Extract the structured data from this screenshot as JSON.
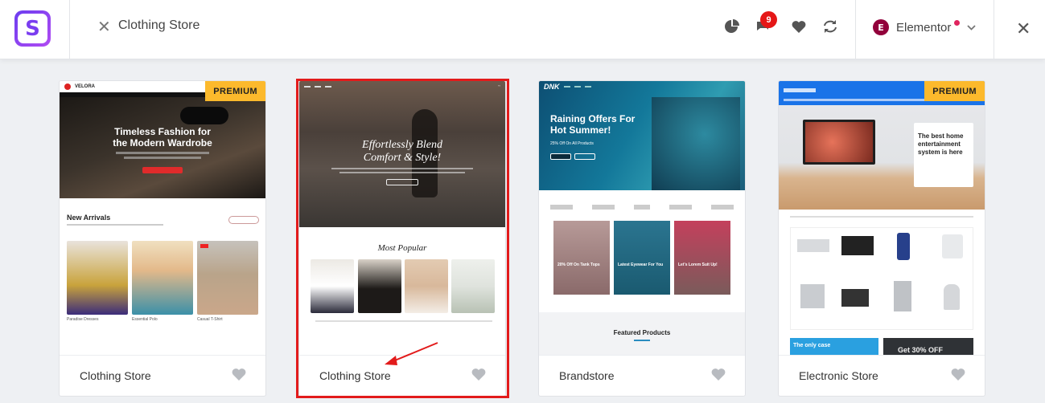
{
  "header": {
    "logo_letter": "S",
    "search_term": "Clothing Store",
    "notification_count": "9",
    "builder": {
      "label": "Elementor",
      "logo_letter": "E"
    }
  },
  "cards": [
    {
      "title": "Clothing Store",
      "badge": "PREMIUM",
      "preview": {
        "brand": "VELORA",
        "hero_title": "Timeless Fashion for the Modern Wardrobe",
        "section": "New Arrivals",
        "products": [
          "Paradise Dresses",
          "Essential Polo",
          "Casual T-Shirt"
        ]
      }
    },
    {
      "title": "Clothing Store",
      "badge": "",
      "preview": {
        "hero_title": "Effortlessly Blend Comfort & Style!",
        "section": "Most Popular"
      }
    },
    {
      "title": "Brandstore",
      "badge": "",
      "preview": {
        "brand": "DNK",
        "hero_title": "Raining Offers For Hot Summer!",
        "hero_sub": "25% Off On All Products",
        "tiles": [
          "20% Off On Tank Tops",
          "Latest Eyewear For You",
          "Let's Lorem Suit Up!"
        ],
        "section": "Featured Products"
      }
    },
    {
      "title": "Electronic Store",
      "badge": "PREMIUM",
      "preview": {
        "hero_title": "The best home entertainment system is here",
        "promo": "The only case",
        "promo2": "Get 30% OFF"
      }
    }
  ],
  "colors": {
    "accent": "#7a3df0",
    "badge": "#fcb92c",
    "highlight": "#e21b1b",
    "notification": "#e51717"
  }
}
